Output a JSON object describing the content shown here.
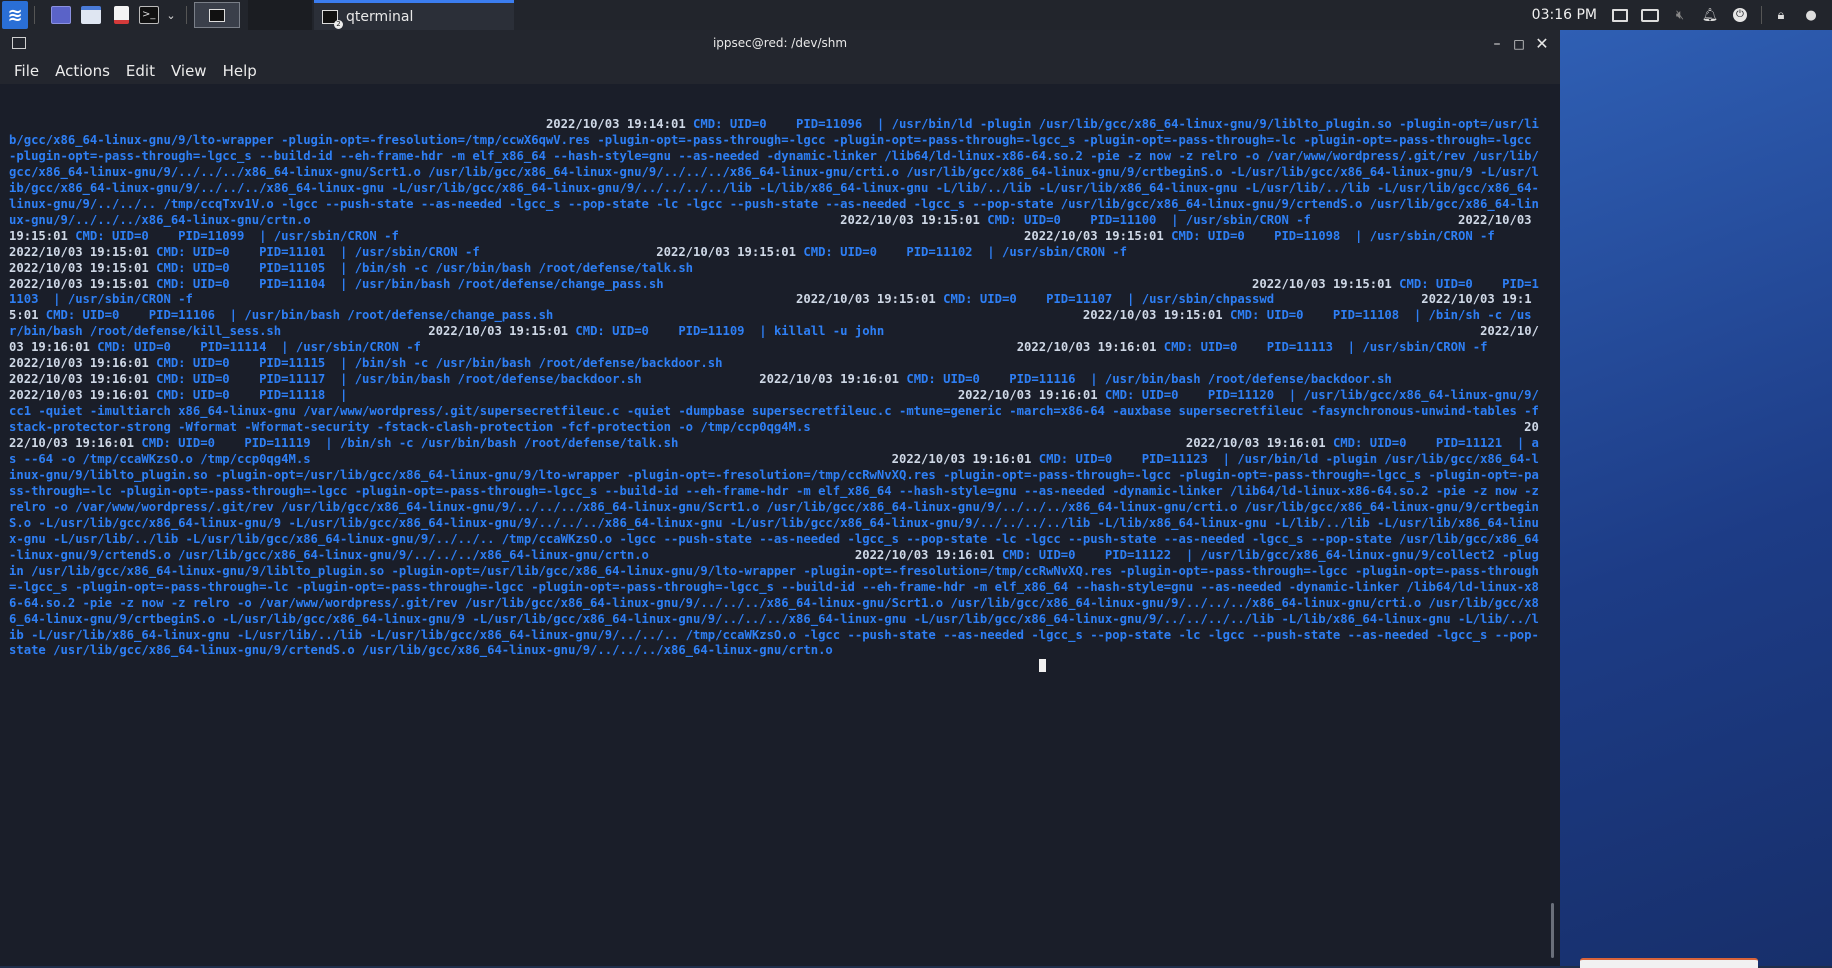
{
  "taskbar": {
    "menu_icon": "kali-dragon-icon",
    "launchers": [
      "desktop-icon",
      "file-manager-icon",
      "text-editor-icon",
      "terminal-icon",
      "chevron-down-icon"
    ],
    "task_label": "qterminal",
    "clock": "03:16 PM",
    "tray_icons": [
      "display-icon",
      "keyboard-icon",
      "volume-icon",
      "bell-icon",
      "power-icon",
      "lock-icon",
      "user-icon"
    ]
  },
  "window": {
    "title": "ippsec@red: /dev/shm",
    "menus": [
      "File",
      "Actions",
      "Edit",
      "View",
      "Help"
    ]
  },
  "colors": {
    "accent": "#2e7ff5",
    "timestamp": "#cfd8e6",
    "terminal_bg": "#1a1e29"
  },
  "terminal": {
    "lines": [
      {
        "pad": 73,
        "ts": "2022/10/03 19:14:01",
        "rest": " CMD: UID=0    PID=11096  | /usr/bin/ld -plugin /usr/lib/gcc/x86_64-linux-gnu/9/liblto_plugin.so -plugin-opt=/usr/lib/gcc/x86_64-linux-gnu/9/lto-wrapper -plugin-opt=-fresolution=/tmp/ccwX6qwV.res -plugin-opt=-pass-through=-lgcc -plugin-opt=-pass-through=-lgcc_s -plugin-opt=-pass-through=-lc -plugin-opt=-pass-through=-lgcc -plugin-opt=-pass-through=-lgcc_s --build-id --eh-frame-hdr -m elf_x86_64 --hash-style=gnu --as-needed -dynamic-linker /lib64/ld-linux-x86-64.so.2 -pie -z now -z relro -o /var/www/wordpress/.git/rev /usr/lib/gcc/x86_64-linux-gnu/9/../../../x86_64-linux-gnu/Scrt1.o /usr/lib/gcc/x86_64-linux-gnu/9/../../../x86_64-linux-gnu/crti.o /usr/lib/gcc/x86_64-linux-gnu/9/crtbeginS.o -L/usr/lib/gcc/x86_64-linux-gnu/9 -L/usr/lib/gcc/x86_64-linux-gnu/9/../../../x86_64-linux-gnu -L/usr/lib/gcc/x86_64-linux-gnu/9/../../../../lib -L/lib/x86_64-linux-gnu -L/lib/../lib -L/usr/lib/x86_64-linux-gnu -L/usr/lib/../lib -L/usr/lib/gcc/x86_64-linux-gnu/9/../../.. /tmp/ccqTxv1V.o -lgcc --push-state --as-needed -lgcc_s --pop-state -lc -lgcc --push-state --as-needed -lgcc_s --pop-state /usr/lib/gcc/x86_64-linux-gnu/9/crtendS.o /usr/lib/gcc/x86_64-linux-gnu/9/../../../x86_64-linux-gnu/crtn.o"
      },
      {
        "pad": 72,
        "ts": "2022/10/03 19:15:01",
        "rest": " CMD: UID=0    PID=11100  | /usr/sbin/CRON -f"
      },
      {
        "pad": 20,
        "ts": "2022/10/03 19:15:01",
        "rest": " CMD: UID=0    PID=11099  | /usr/sbin/CRON -f"
      },
      {
        "pad": 85,
        "ts": "2022/10/03 19:15:01",
        "rest": " CMD: UID=0    PID=11098  | /usr/sbin/CRON -f"
      },
      {
        "pad": 84,
        "ts": "2022/10/03 19:15:01",
        "rest": " CMD: UID=0    PID=11101  | /usr/sbin/CRON -f"
      },
      {
        "pad": 24,
        "ts": "2022/10/03 19:15:01",
        "rest": " CMD: UID=0    PID=11102  | /usr/sbin/CRON -f"
      },
      {
        "pad": 89,
        "ts": "2022/10/03 19:15:01",
        "rest": " CMD: UID=0    PID=11105  | /bin/sh -c /usr/bin/bash /root/defense/talk.sh"
      },
      {
        "pad": 182,
        "ts": "2022/10/03 19:15:01",
        "rest": " CMD: UID=0    PID=11104  | /usr/bin/bash /root/defense/change_pass.sh"
      },
      {
        "pad": 80,
        "ts": "2022/10/03 19:15:01",
        "rest": " CMD: UID=0    PID=11103  | /usr/sbin/CRON -f"
      },
      {
        "pad": 82,
        "ts": "2022/10/03 19:15:01",
        "rest": " CMD: UID=0    PID=11107  | /usr/sbin/chpasswd"
      },
      {
        "pad": 20,
        "ts": "2022/10/03 19:15:01",
        "rest": " CMD: UID=0    PID=11106  | /usr/bin/bash /root/defense/change_pass.sh"
      },
      {
        "pad": 72,
        "ts": "2022/10/03 19:15:01",
        "rest": " CMD: UID=0    PID=11108  | /bin/sh -c /usr/bin/bash /root/defense/kill_sess.sh"
      },
      {
        "pad": 20,
        "ts": "2022/10/03 19:15:01",
        "rest": " CMD: UID=0    PID=11109  | killall -u john"
      },
      {
        "pad": 81,
        "ts": "2022/10/03 19:16:01",
        "rest": " CMD: UID=0    PID=11114  | /usr/sbin/CRON -f"
      },
      {
        "pad": 81,
        "ts": "2022/10/03 19:16:01",
        "rest": " CMD: UID=0    PID=11113  | /usr/sbin/CRON -f"
      },
      {
        "pad": 22,
        "ts": "2022/10/03 19:16:01",
        "rest": " CMD: UID=0    PID=11115  | /bin/sh -c /usr/bin/bash /root/defense/backdoor.sh"
      },
      {
        "pad": 121,
        "ts": "2022/10/03 19:16:01",
        "rest": " CMD: UID=0    PID=11117  | /usr/bin/bash /root/defense/backdoor.sh"
      },
      {
        "pad": 16,
        "ts": "2022/10/03 19:16:01",
        "rest": " CMD: UID=0    PID=11116  | /usr/bin/bash /root/defense/backdoor.sh"
      },
      {
        "pad": 71,
        "ts": "2022/10/03 19:16:01",
        "rest": " CMD: UID=0    PID=11118  | "
      },
      {
        "pad": 82,
        "ts": "2022/10/03 19:16:01",
        "rest": " CMD: UID=0    PID=11120  | /usr/lib/gcc/x86_64-linux-gnu/9/cc1 -quiet -imultiarch x86_64-linux-gnu /var/www/wordpress/.git/supersecretfileuc.c -quiet -dumpbase supersecretfileuc.c -mtune=generic -march=x86-64 -auxbase supersecretfileuc -fasynchronous-unwind-tables -fstack-protector-strong -Wformat -Wformat-security -fstack-clash-protection -fcf-protection -o /tmp/ccp0qg4M.s"
      },
      {
        "pad": 97,
        "ts": "2022/10/03 19:16:01",
        "rest": " CMD: UID=0    PID=11119  | /bin/sh -c /usr/bin/bash /root/defense/talk.sh"
      },
      {
        "pad": 69,
        "ts": "2022/10/03 19:16:01",
        "rest": " CMD: UID=0    PID=11121  | as --64 -o /tmp/ccaWKzsO.o /tmp/ccp0qg4M.s"
      },
      {
        "pad": 79,
        "ts": "2022/10/03 19:16:01",
        "rest": " CMD: UID=0    PID=11123  | /usr/bin/ld -plugin /usr/lib/gcc/x86_64-linux-gnu/9/liblto_plugin.so -plugin-opt=/usr/lib/gcc/x86_64-linux-gnu/9/lto-wrapper -plugin-opt=-fresolution=/tmp/ccRwNvXQ.res -plugin-opt=-pass-through=-lgcc -plugin-opt=-pass-through=-lgcc_s -plugin-opt=-pass-through=-lc -plugin-opt=-pass-through=-lgcc -plugin-opt=-pass-through=-lgcc_s --build-id --eh-frame-hdr -m elf_x86_64 --hash-style=gnu --as-needed -dynamic-linker /lib64/ld-linux-x86-64.so.2 -pie -z now -z relro -o /var/www/wordpress/.git/rev /usr/lib/gcc/x86_64-linux-gnu/9/../../../x86_64-linux-gnu/Scrt1.o /usr/lib/gcc/x86_64-linux-gnu/9/../../../x86_64-linux-gnu/crti.o /usr/lib/gcc/x86_64-linux-gnu/9/crtbeginS.o -L/usr/lib/gcc/x86_64-linux-gnu/9 -L/usr/lib/gcc/x86_64-linux-gnu/9/../../../x86_64-linux-gnu -L/usr/lib/gcc/x86_64-linux-gnu/9/../../../../lib -L/lib/x86_64-linux-gnu -L/lib/../lib -L/usr/lib/x86_64-linux-gnu -L/usr/lib/../lib -L/usr/lib/gcc/x86_64-linux-gnu/9/../../.. /tmp/ccaWKzsO.o -lgcc --push-state --as-needed -lgcc_s --pop-state -lc -lgcc --push-state --as-needed -lgcc_s --pop-state /usr/lib/gcc/x86_64-linux-gnu/9/crtendS.o /usr/lib/gcc/x86_64-linux-gnu/9/../../../x86_64-linux-gnu/crtn.o"
      },
      {
        "pad": 28,
        "ts": "2022/10/03 19:16:01",
        "rest": " CMD: UID=0    PID=11122  | /usr/lib/gcc/x86_64-linux-gnu/9/collect2 -plugin /usr/lib/gcc/x86_64-linux-gnu/9/liblto_plugin.so -plugin-opt=/usr/lib/gcc/x86_64-linux-gnu/9/lto-wrapper -plugin-opt=-fresolution=/tmp/ccRwNvXQ.res -plugin-opt=-pass-through=-lgcc -plugin-opt=-pass-through=-lgcc_s -plugin-opt=-pass-through=-lc -plugin-opt=-pass-through=-lgcc -plugin-opt=-pass-through=-lgcc_s --build-id --eh-frame-hdr -m elf_x86_64 --hash-style=gnu --as-needed -dynamic-linker /lib64/ld-linux-x86-64.so.2 -pie -z now -z relro -o /var/www/wordpress/.git/rev /usr/lib/gcc/x86_64-linux-gnu/9/../../../x86_64-linux-gnu/Scrt1.o /usr/lib/gcc/x86_64-linux-gnu/9/../../../x86_64-linux-gnu/crti.o /usr/lib/gcc/x86_64-linux-gnu/9/crtbeginS.o -L/usr/lib/gcc/x86_64-linux-gnu/9 -L/usr/lib/gcc/x86_64-linux-gnu/9/../../../x86_64-linux-gnu -L/usr/lib/gcc/x86_64-linux-gnu/9/../../../../lib -L/lib/x86_64-linux-gnu -L/lib/../lib -L/usr/lib/x86_64-linux-gnu -L/usr/lib/../lib -L/usr/lib/gcc/x86_64-linux-gnu/9/../../.. /tmp/ccaWKzsO.o -lgcc --push-state --as-needed -lgcc_s --pop-state -lc -lgcc --push-state --as-needed -lgcc_s --pop-state /usr/lib/gcc/x86_64-linux-gnu/9/crtendS.o /usr/lib/gcc/x86_64-linux-gnu/9/../../../x86_64-linux-gnu/crtn.o"
      }
    ]
  }
}
